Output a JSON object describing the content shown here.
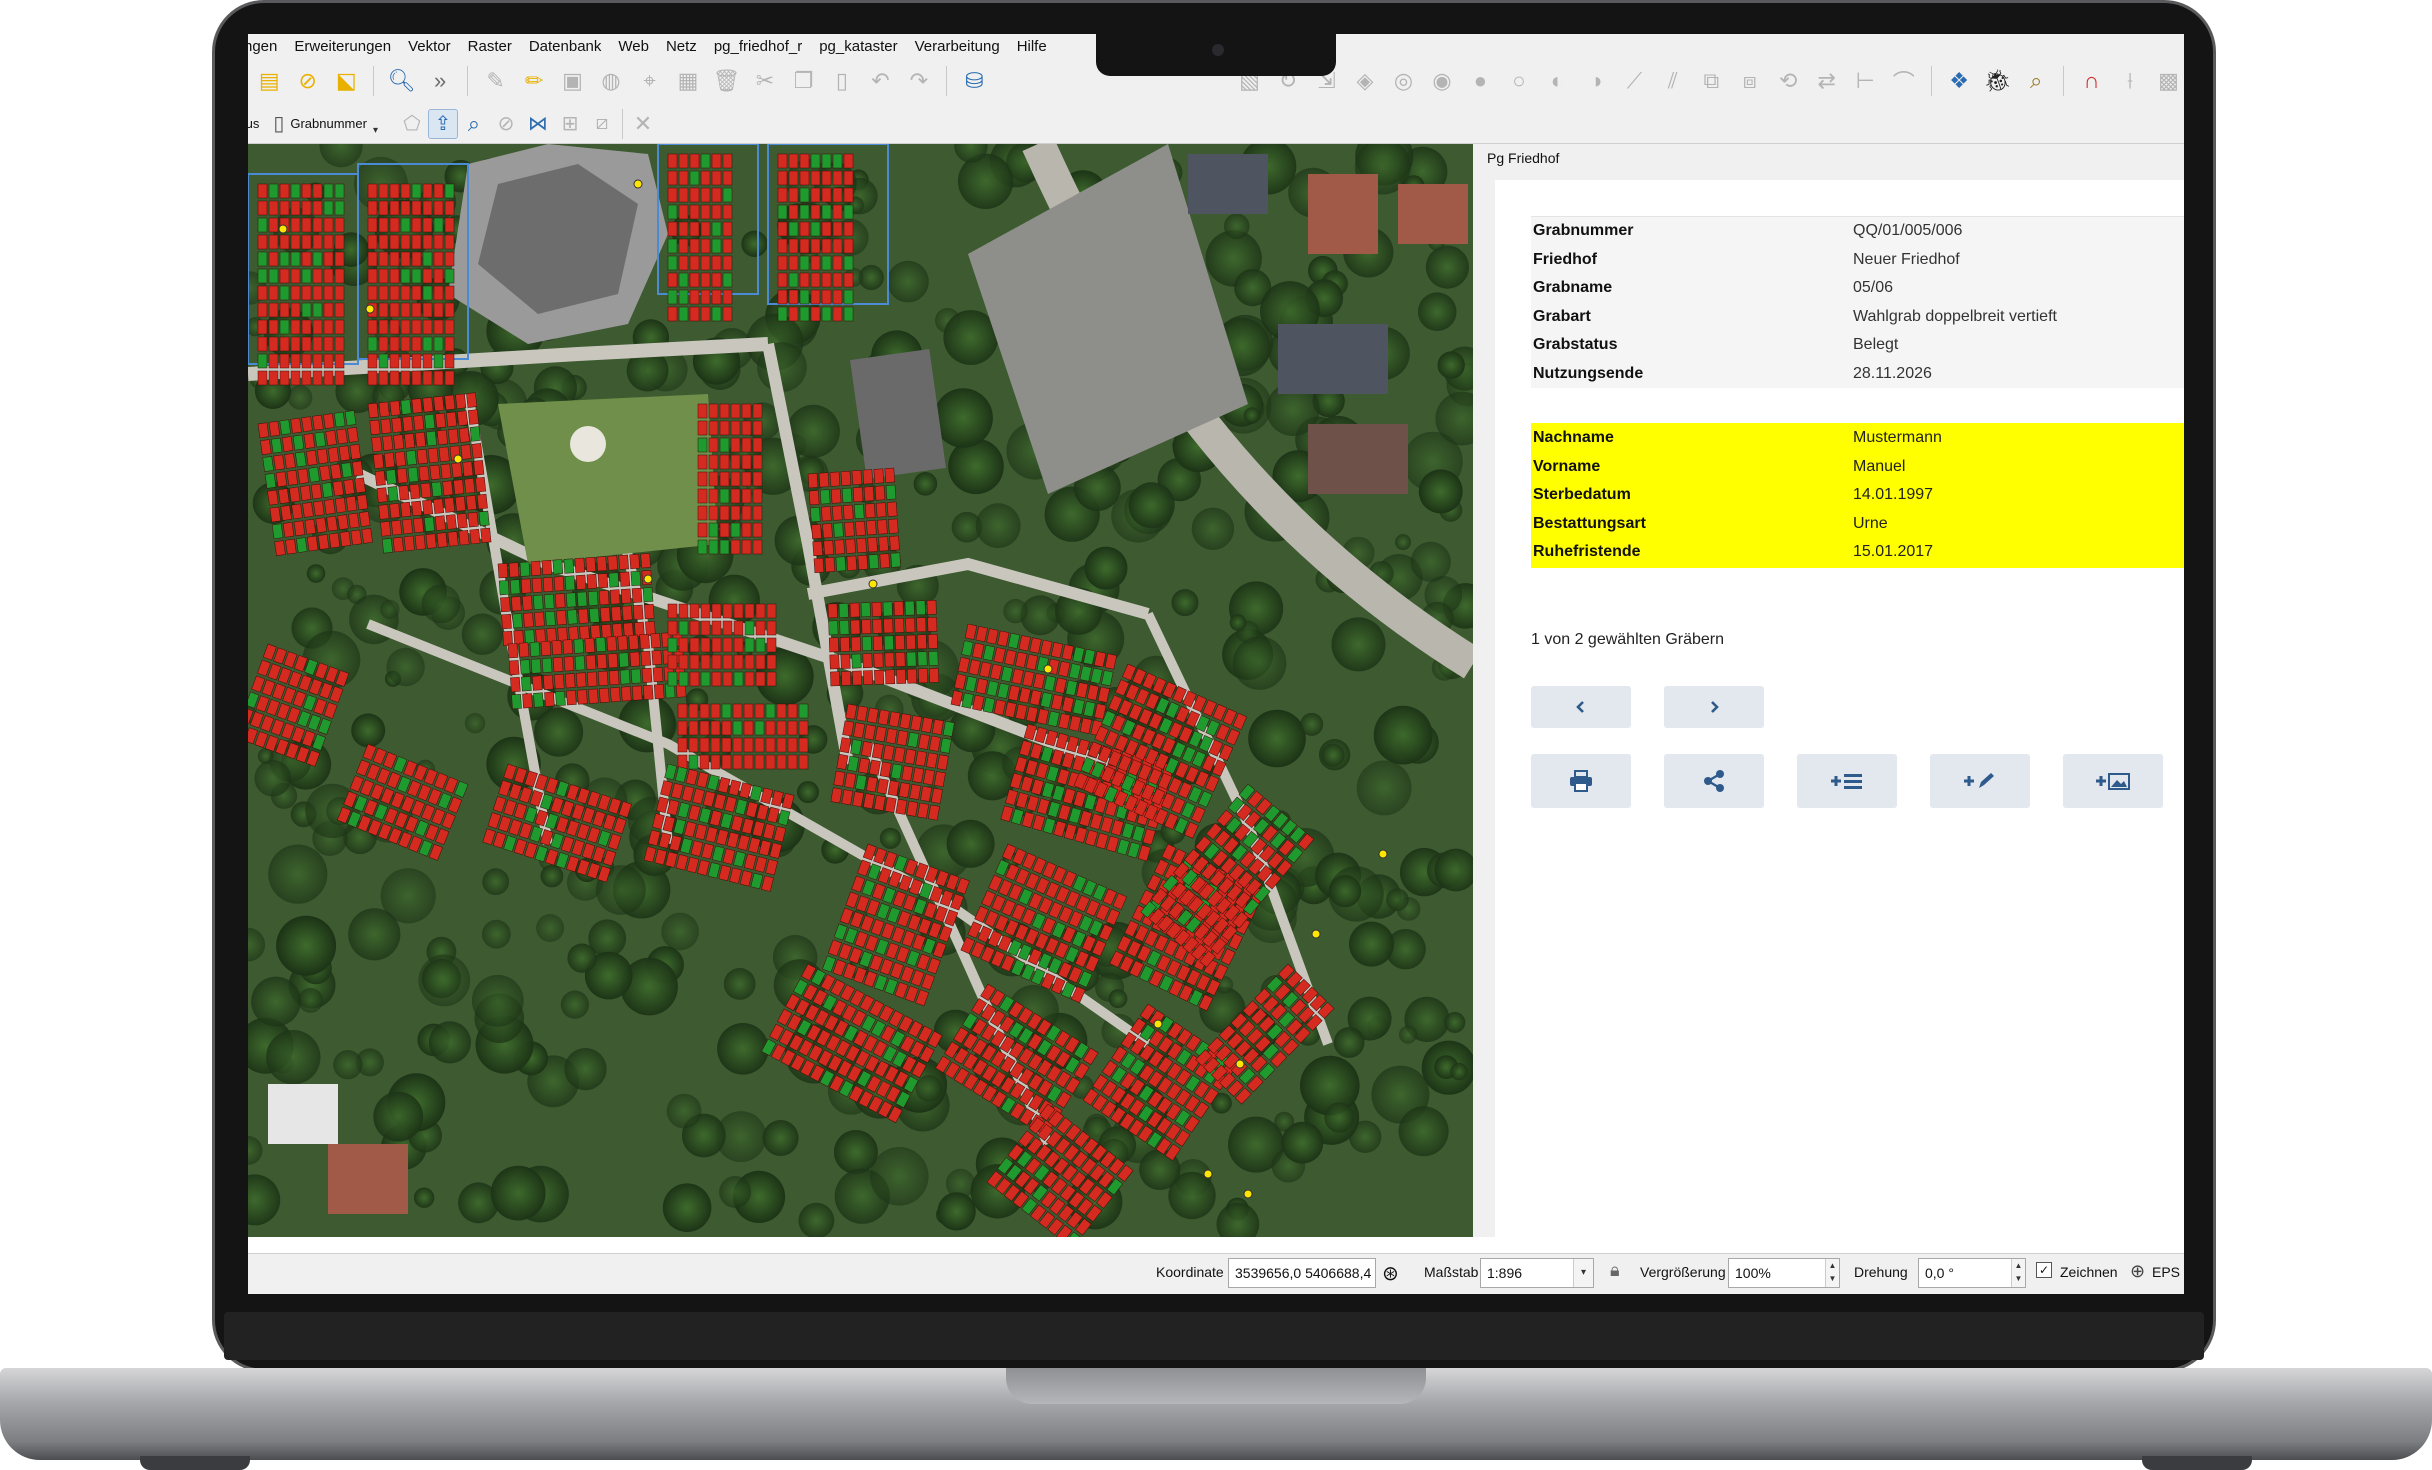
{
  "menu": [
    "ngen",
    "Erweiterungen",
    "Vektor",
    "Raster",
    "Datenbank",
    "Web",
    "Netz",
    "pg_friedhof_r",
    "pg_kataster",
    "Verarbeitung",
    "Hilfe"
  ],
  "toolbar2": {
    "status_label": "tus",
    "grab_label": "Grabnummer"
  },
  "panel": {
    "title": "Pg Friedhof",
    "grave": [
      {
        "key": "Grabnummer",
        "value": "QQ/01/005/006"
      },
      {
        "key": "Friedhof",
        "value": "Neuer Friedhof"
      },
      {
        "key": "Grabname",
        "value": "05/06"
      },
      {
        "key": "Grabart",
        "value": "Wahlgrab doppelbreit vertieft"
      },
      {
        "key": "Grabstatus",
        "value": "Belegt"
      },
      {
        "key": "Nutzungsende",
        "value": "28.11.2026"
      }
    ],
    "person": [
      {
        "key": "Nachname",
        "value": "Mustermann"
      },
      {
        "key": "Vorname",
        "value": "Manuel"
      },
      {
        "key": "Sterbedatum",
        "value": "14.01.1997"
      },
      {
        "key": "Bestattungsart",
        "value": "Urne"
      },
      {
        "key": "Ruhefristende",
        "value": "15.01.2017"
      }
    ],
    "selection_count": "1 von 2 gewählten Gräbern",
    "highlight_color": "#ffff00"
  },
  "status": {
    "coord_label": "Koordinate",
    "coord_value": "3539656,0 5406688,4",
    "scale_label": "Maßstab",
    "scale_value": "1:896",
    "zoom_label": "Vergrößerung",
    "zoom_value": "100%",
    "rotation_label": "Drehung",
    "rotation_value": "0,0 °",
    "render_label": "Zeichnen",
    "epsg_label": "EPS"
  },
  "icons": {
    "prev": "chevron-left-icon",
    "next": "chevron-right-icon",
    "print": "printer-icon",
    "share": "share-icon",
    "add_list": "add-list-icon",
    "add_edit": "add-edit-icon",
    "add_image": "add-image-icon"
  },
  "colors": {
    "occupied": "#d42a1f",
    "free": "#1f9a2e",
    "accent": "#2e5a8c"
  }
}
